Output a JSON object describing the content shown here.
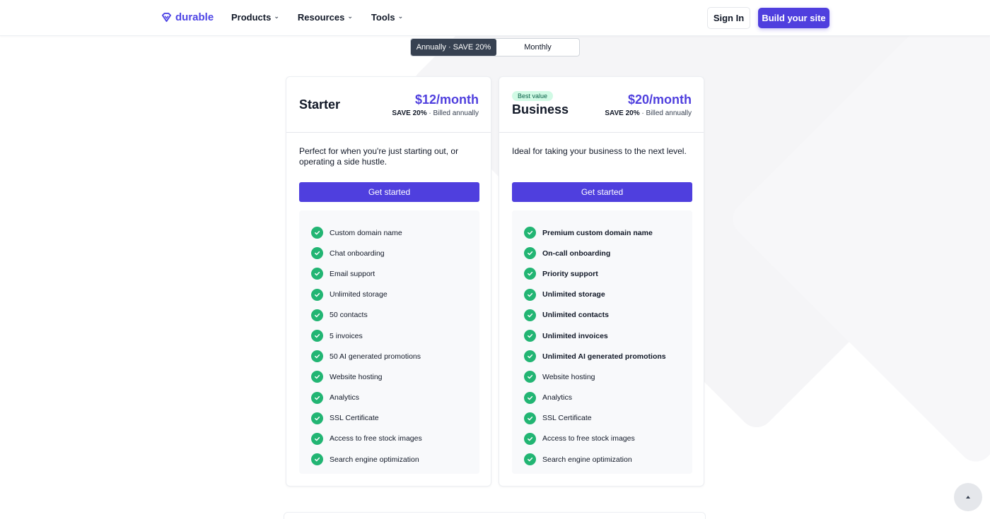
{
  "header": {
    "logo_text": "durable",
    "nav": [
      {
        "label": "Products"
      },
      {
        "label": "Resources"
      },
      {
        "label": "Tools"
      }
    ],
    "sign_in": "Sign In",
    "build_site": "Build your site"
  },
  "billing_toggle": {
    "annually": "Annually · SAVE 20%",
    "monthly": "Monthly",
    "selected": "annually"
  },
  "plans": [
    {
      "name": "Starter",
      "badge": "",
      "price": "$12/month",
      "save": "SAVE 20%",
      "billing": "· Billed annually",
      "description": "Perfect for when you're just starting out, or operating a side hustle.",
      "cta": "Get started",
      "features": [
        {
          "text": "Custom domain name",
          "bold": false
        },
        {
          "text": "Chat onboarding",
          "bold": false
        },
        {
          "text": "Email support",
          "bold": false
        },
        {
          "text": "Unlimited storage",
          "bold": false
        },
        {
          "text": "50 contacts",
          "bold": false
        },
        {
          "text": "5 invoices",
          "bold": false
        },
        {
          "text": "50 AI generated promotions",
          "bold": false
        },
        {
          "text": "Website hosting",
          "bold": false
        },
        {
          "text": "Analytics",
          "bold": false
        },
        {
          "text": "SSL Certificate",
          "bold": false
        },
        {
          "text": "Access to free stock images",
          "bold": false
        },
        {
          "text": "Search engine optimization",
          "bold": false
        }
      ]
    },
    {
      "name": "Business",
      "badge": "Best value",
      "price": "$20/month",
      "save": "SAVE 20%",
      "billing": "· Billed annually",
      "description": "Ideal for taking your business to the next level.",
      "cta": "Get started",
      "features": [
        {
          "text": "Premium custom domain name",
          "bold": true
        },
        {
          "text": "On-call onboarding",
          "bold": true
        },
        {
          "text": "Priority support",
          "bold": true
        },
        {
          "text": "Unlimited storage",
          "bold": true
        },
        {
          "text": "Unlimited contacts",
          "bold": true
        },
        {
          "text": "Unlimited invoices",
          "bold": true
        },
        {
          "text": "Unlimited AI generated promotions",
          "bold": true
        },
        {
          "text": "Website hosting",
          "bold": false
        },
        {
          "text": "Analytics",
          "bold": false
        },
        {
          "text": "SSL Certificate",
          "bold": false
        },
        {
          "text": "Access to free stock images",
          "bold": false
        },
        {
          "text": "Search engine optimization",
          "bold": false
        }
      ]
    }
  ],
  "colors": {
    "brand": "#4f3fde",
    "check": "#22b573",
    "badge_bg": "#d1fae5"
  },
  "icons": {
    "logo": "durable-logo-icon",
    "check": "check-circle-icon",
    "chevron": "chevron-down-icon",
    "scroll_top": "arrow-up-icon"
  }
}
